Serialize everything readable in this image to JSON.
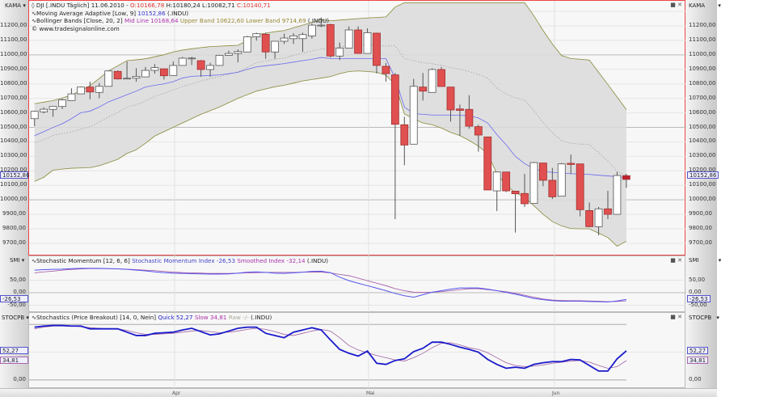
{
  "colors": {
    "up": "#ffffff",
    "down": "#e05050",
    "kama": "#6a6af0",
    "band": "#8a8a3a",
    "bandfill": "#dadada",
    "smi": "#5555ee",
    "smoothed": "#a050a0",
    "quick": "#1a1acc",
    "slow": "#a060a0",
    "selected": "#e44444"
  },
  "price_pane": {
    "axis_title": "KAMA",
    "menu_icon": "dropdown-arrow",
    "header": {
      "symbol": "DJI [.INDU  Täglich]",
      "date": "11.06.2010",
      "open": "O:10166,78",
      "high": "H:10180,24",
      "low": "L:10082,71",
      "close": "C:10140,71"
    },
    "legend": [
      {
        "name": "Moving Average Adaptive [Low, 9]",
        "v1": "10152,86",
        "suffix": "(.INDU)"
      },
      {
        "name": "Bollinger Bands [Close, 20, 2]",
        "mid": "Mid Line 10168,64",
        "upper": "Upper Band 10622,60",
        "lower": "Lower Band 9714,69",
        "suffix": "(.INDU)"
      }
    ],
    "copyright": "© www.tradesignalonline.com",
    "ticks": [
      "11200,00",
      "11100,00",
      "11000,00",
      "10900,00",
      "10800,00",
      "10700,00",
      "10600,00",
      "10500,00",
      "10400,00",
      "10300,00",
      "10200,00",
      "10100,00",
      "10000,00",
      "9900,00",
      "9800,00",
      "9700,00"
    ],
    "tag": "10152,86"
  },
  "smi_pane": {
    "axis_title": "SMI",
    "legend": {
      "name": "Stochastic Momentum [12, 6, 6]",
      "v1": "Stochastic Momentum Index -26,53",
      "v2": "Smoothed Index -32,14",
      "suffix": "(.INDU)"
    },
    "ticks": [
      "50,00",
      "0,00",
      "-50,00"
    ],
    "tag": "-26,53"
  },
  "stoch_pane": {
    "axis_title": "STOCPB",
    "legend": {
      "name": "Stochastics (Price Breakout) [14, 0, Nein]",
      "v1": "Quick 52,27",
      "v2": "Slow 34,81",
      "v3": "Raw -/-",
      "suffix": "(.INDU)"
    },
    "ticks": [
      "0,00"
    ],
    "tags": [
      "52,27",
      "34,81"
    ]
  },
  "time_axis": [
    "Apr",
    "Mai",
    "Jun"
  ],
  "chart_data": {
    "type": "candlestick",
    "ylim": [
      9650,
      11350
    ],
    "ohlc": [
      [
        10560,
        10615,
        10508,
        10611
      ],
      [
        10607,
        10638,
        10596,
        10625
      ],
      [
        10624,
        10646,
        10573,
        10644
      ],
      [
        10644,
        10698,
        10626,
        10689
      ],
      [
        10685,
        10769,
        10685,
        10731
      ],
      [
        10731,
        10782,
        10731,
        10778
      ],
      [
        10778,
        10815,
        10694,
        10744
      ],
      [
        10741,
        10806,
        10700,
        10783
      ],
      [
        10783,
        10893,
        10783,
        10889
      ],
      [
        10886,
        10893,
        10830,
        10834
      ],
      [
        10838,
        10954,
        10836,
        10839
      ],
      [
        10839,
        10908,
        10815,
        10852
      ],
      [
        10848,
        10917,
        10848,
        10893
      ],
      [
        10893,
        10936,
        10871,
        10912
      ],
      [
        10904,
        10904,
        10830,
        10856
      ],
      [
        10858,
        10954,
        10858,
        10927
      ],
      [
        10927,
        10986,
        10927,
        10977
      ],
      [
        10977,
        10986,
        10930,
        10978
      ],
      [
        10960,
        10964,
        10849,
        10899
      ],
      [
        10899,
        10945,
        10849,
        10927
      ],
      [
        10927,
        11001,
        10927,
        10997
      ],
      [
        10997,
        11029,
        10997,
        11010
      ],
      [
        11010,
        11038,
        10949,
        11023
      ],
      [
        11020,
        11131,
        11020,
        11125
      ],
      [
        11125,
        11153,
        11098,
        11146
      ],
      [
        11142,
        11153,
        10973,
        11020
      ],
      [
        11020,
        11094,
        10973,
        11094
      ],
      [
        11094,
        11146,
        11075,
        11116
      ],
      [
        11112,
        11150,
        11075,
        11131
      ],
      [
        11112,
        11153,
        11020,
        11140
      ],
      [
        11131,
        11215,
        11112,
        11205
      ],
      [
        11205,
        11258,
        11191,
        11205
      ],
      [
        11209,
        11215,
        10982,
        10992
      ],
      [
        10992,
        11085,
        10964,
        11047
      ],
      [
        11047,
        11196,
        11047,
        11172
      ],
      [
        11172,
        11196,
        11010,
        11010
      ],
      [
        11010,
        11183,
        11010,
        11153
      ],
      [
        11150,
        11153,
        10871,
        10927
      ],
      [
        10921,
        10945,
        10815,
        10871
      ],
      [
        10862,
        10875,
        9867,
        10521
      ],
      [
        10518,
        10573,
        10239,
        10378
      ],
      [
        10384,
        10834,
        10384,
        10783
      ],
      [
        10778,
        10875,
        10685,
        10750
      ],
      [
        10741,
        10908,
        10741,
        10899
      ],
      [
        10899,
        10917,
        10782,
        10782
      ],
      [
        10778,
        10778,
        10540,
        10620
      ],
      [
        10627,
        10657,
        10443,
        10617
      ],
      [
        10624,
        10722,
        10490,
        10508
      ],
      [
        10505,
        10518,
        10332,
        10447
      ],
      [
        10434,
        10434,
        10068,
        10068
      ],
      [
        10062,
        10192,
        9923,
        10192
      ],
      [
        10192,
        10192,
        10053,
        10062
      ],
      [
        10060,
        10060,
        9774,
        10042
      ],
      [
        10044,
        10179,
        9951,
        9973
      ],
      [
        9975,
        10261,
        9975,
        10257
      ],
      [
        10254,
        10254,
        10094,
        10135
      ],
      [
        10135,
        10220,
        10006,
        10021
      ],
      [
        10025,
        10254,
        10025,
        10248
      ],
      [
        10252,
        10313,
        10179,
        10244
      ],
      [
        10248,
        10248,
        9886,
        9932
      ],
      [
        9926,
        9982,
        9811,
        9815
      ],
      [
        9815,
        9951,
        9755,
        9938
      ],
      [
        9938,
        10062,
        9867,
        9900
      ],
      [
        9900,
        10192,
        9900,
        10168
      ],
      [
        10166.78,
        10180.24,
        10082.71,
        10140.71
      ]
    ],
    "bollinger_upper": [
      10663,
      10674,
      10685,
      10703,
      10722,
      10755,
      10787,
      10838,
      10889,
      10925,
      10960,
      10966,
      10973,
      10987,
      11001,
      11020,
      11033,
      11042,
      11050,
      11057,
      11060,
      11063,
      11066,
      11100,
      11140,
      11150,
      11160,
      11168,
      11187,
      11205,
      11224,
      11243,
      11235,
      11240,
      11245,
      11250,
      11255,
      11258,
      11262,
      11330,
      11360,
      11360,
      11360,
      11360,
      11360,
      11360,
      11360,
      11360,
      11360,
      11360,
      11360,
      11360,
      11360,
      11360,
      11270,
      11168,
      11075,
      10995,
      10975,
      10970,
      10964,
      10880,
      10796,
      10710,
      10622.6
    ],
    "bollinger_lower": [
      10127,
      10155,
      10205,
      10212,
      10218,
      10220,
      10222,
      10235,
      10257,
      10280,
      10320,
      10345,
      10390,
      10440,
      10470,
      10500,
      10530,
      10560,
      10590,
      10615,
      10640,
      10670,
      10700,
      10725,
      10750,
      10765,
      10780,
      10790,
      10805,
      10820,
      10830,
      10840,
      10850,
      10870,
      10885,
      10889,
      10885,
      10880,
      10860,
      10796,
      10592,
      10560,
      10530,
      10518,
      10495,
      10465,
      10443,
      10410,
      10370,
      10320,
      10180,
      10100,
      10050,
      10016,
      9960,
      9900,
      9850,
      9820,
      9802,
      9800,
      9800,
      9770,
      9740,
      9680,
      9714.69
    ],
    "kama": [
      10443,
      10470,
      10499,
      10525,
      10560,
      10601,
      10612,
      10640,
      10676,
      10700,
      10725,
      10750,
      10778,
      10790,
      10800,
      10815,
      10840,
      10852,
      10855,
      10858,
      10862,
      10870,
      10880,
      10900,
      10917,
      10925,
      10932,
      10940,
      10950,
      10960,
      10970,
      10982,
      10975,
      10975,
      10975,
      10975,
      10975,
      10975,
      10975,
      10840,
      10640,
      10595,
      10590,
      10585,
      10585,
      10585,
      10583,
      10580,
      10565,
      10530,
      10450,
      10380,
      10300,
      10250,
      10215,
      10195,
      10190,
      10185,
      10180,
      10178,
      10175,
      10170,
      10165,
      10160,
      10152.86
    ],
    "smi": {
      "ylim": [
        -55,
        130
      ],
      "index": [
        90,
        92,
        93,
        94,
        96,
        97,
        97,
        97,
        96,
        95,
        93,
        90,
        87,
        83,
        80,
        78,
        77,
        76,
        75,
        74,
        74,
        75,
        78,
        82,
        83,
        81,
        78,
        77,
        79,
        82,
        85,
        86,
        80,
        62,
        48,
        38,
        28,
        18,
        8,
        -3,
        -12,
        -18,
        -8,
        2,
        8,
        14,
        19,
        19,
        19,
        14,
        8,
        1,
        -6,
        -14,
        -23,
        -28,
        -32,
        -34,
        -34,
        -34,
        -35,
        -36,
        -37,
        -33,
        -26.53
      ],
      "smoothed": [
        79,
        83,
        86,
        90,
        93,
        95,
        96,
        96,
        96,
        95,
        94,
        92,
        90,
        88,
        85,
        82,
        80,
        79,
        78,
        77,
        77,
        77,
        78,
        79,
        80,
        81,
        81,
        81,
        81,
        82,
        82,
        82,
        79,
        73,
        68,
        58,
        48,
        38,
        28,
        16,
        8,
        2,
        1,
        2,
        4,
        8,
        12,
        16,
        16,
        12,
        8,
        4,
        -2,
        -10,
        -18,
        -25,
        -29,
        -31,
        -32,
        -32,
        -33,
        -34,
        -36,
        -35,
        -32.14
      ]
    },
    "stochastics": {
      "ylim": [
        -3,
        127
      ],
      "levels": [
        100,
        0
      ],
      "quick": [
        95,
        97,
        98,
        98,
        97,
        97,
        92,
        92,
        92,
        92,
        86,
        80,
        80,
        84,
        85,
        86,
        90,
        93,
        87,
        81,
        83,
        88,
        93,
        95,
        95,
        84,
        80,
        76,
        86,
        90,
        94,
        90,
        72,
        55,
        48,
        43,
        52,
        30,
        28,
        35,
        38,
        51,
        57,
        68,
        68,
        64,
        59,
        55,
        50,
        37,
        28,
        21,
        23,
        21,
        28,
        31,
        33,
        33,
        37,
        36,
        26,
        16,
        16,
        38,
        52.27
      ],
      "slow": [
        92,
        95,
        97,
        97,
        97,
        96,
        94,
        93,
        92,
        92,
        89,
        85,
        82,
        82,
        83,
        84,
        86,
        88,
        89,
        87,
        85,
        86,
        88,
        91,
        93,
        91,
        87,
        82,
        80,
        84,
        88,
        91,
        88,
        76,
        62,
        54,
        49,
        44,
        40,
        36,
        34,
        40,
        48,
        58,
        66,
        67,
        63,
        58,
        55,
        49,
        40,
        31,
        26,
        24,
        25,
        27,
        30,
        32,
        34,
        35,
        32,
        26,
        21,
        24,
        34.81
      ]
    }
  }
}
